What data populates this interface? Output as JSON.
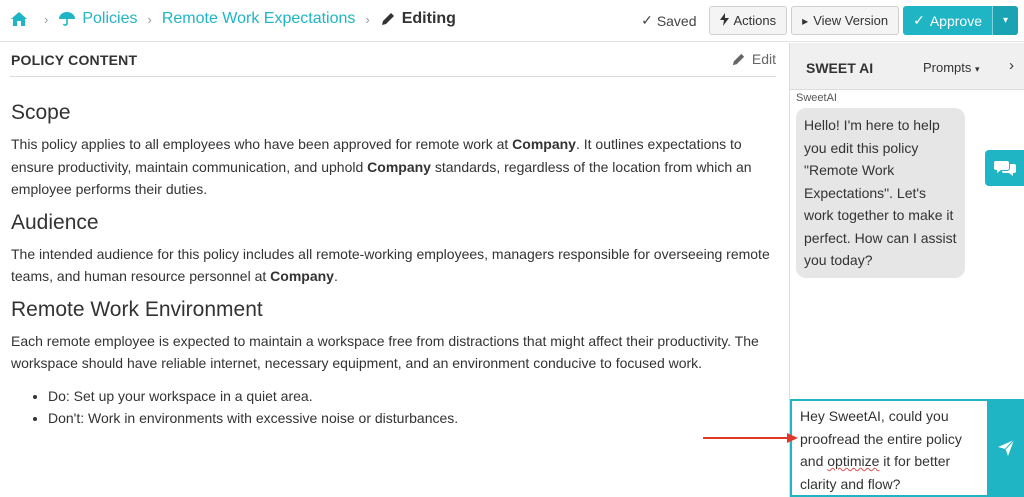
{
  "breadcrumb": {
    "policies": "Policies",
    "doc": "Remote Work Expectations",
    "current": "Editing"
  },
  "toolbar": {
    "saved": "Saved",
    "actions": "Actions",
    "view_version": "View Version",
    "approve": "Approve"
  },
  "section": {
    "title": "POLICY CONTENT",
    "edit": "Edit"
  },
  "content": {
    "scope_heading": "Scope",
    "scope_p_1": "This policy applies to all employees who have been approved for remote work at ",
    "scope_p_b1": "Company",
    "scope_p_2": ". It outlines expectations to ensure productivity, maintain communication, and uphold ",
    "scope_p_b2": "Company",
    "scope_p_3": " standards, regardless of the location from which an employee performs their duties.",
    "audience_heading": "Audience",
    "audience_p_1": "The intended audience for this policy includes all remote-working employees, managers responsible for overseeing remote teams, and human resource personnel at ",
    "audience_p_b1": "Company",
    "audience_p_2": ".",
    "env_heading": "Remote Work Environment",
    "env_p": "Each remote employee is expected to maintain a workspace free from distractions that might affect their productivity. The workspace should have reliable internet, necessary equipment, and an environment conducive to focused work.",
    "env_items": [
      "Do: Set up your workspace in a quiet area.",
      "Don't: Work in environments with excessive noise or disturbances."
    ]
  },
  "ai": {
    "title": "SWEET AI",
    "prompts": "Prompts",
    "sender": "SweetAI",
    "greeting": "Hello! I'm here to help you edit this policy \"Remote Work Expectations\". Let's work together to make it perfect. How can I assist you today?",
    "input_1": "Hey SweetAI, could you proofread the entire policy and ",
    "input_spell": "optimize",
    "input_2": " it for better clarity and flow?"
  },
  "colors": {
    "accent": "#1fb5c5",
    "arrow": "#e0392b"
  }
}
